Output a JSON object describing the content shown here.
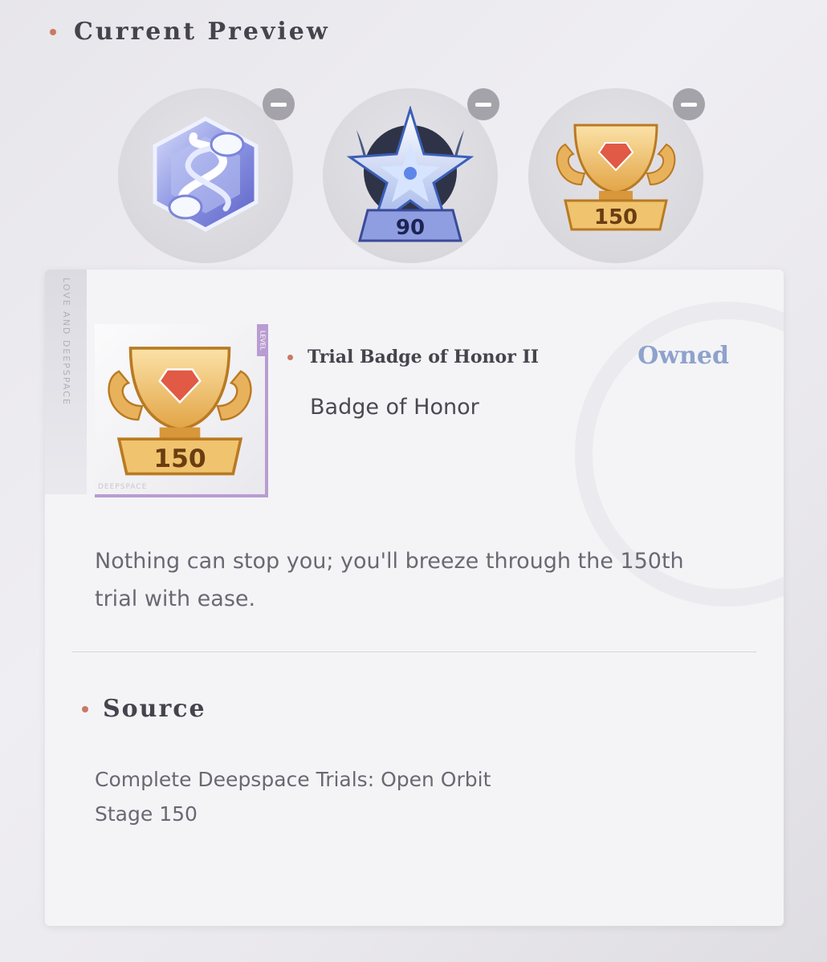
{
  "header": {
    "title": "Current Preview"
  },
  "preview_slots": [
    {
      "name": "dna-badge",
      "remove_label": "remove"
    },
    {
      "name": "star-badge",
      "level": "90",
      "remove_label": "remove"
    },
    {
      "name": "trophy-badge",
      "level": "150",
      "remove_label": "remove"
    }
  ],
  "card": {
    "side_label": "LOVE AND DEEPSPACE",
    "thumb_tag": "LEVEL",
    "thumb_brand": "DEEPSPACE",
    "thumb_level": "150",
    "item_name": "Trial Badge of Honor II",
    "status": "Owned",
    "item_type": "Badge of Honor",
    "description": "Nothing can stop you; you'll breeze through the 150th trial with ease.",
    "source_title": "Source",
    "source_text": "Complete Deepspace Trials: Open Orbit Stage 150"
  },
  "colors": {
    "accent_dot": "#c97964",
    "owned": "#8ea2cc",
    "thumb_border": "#b99cd1"
  }
}
